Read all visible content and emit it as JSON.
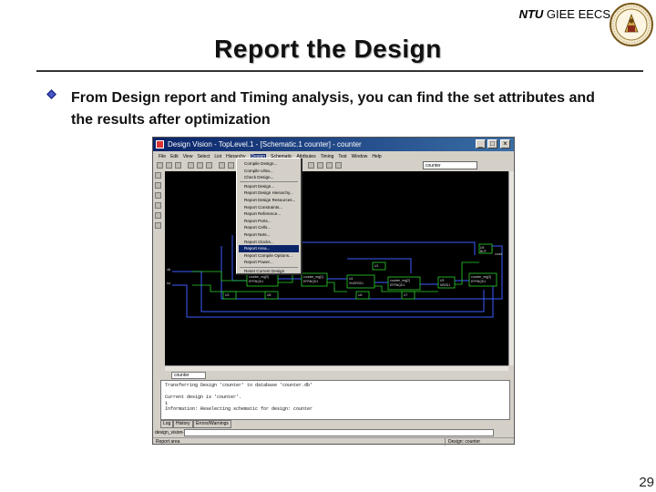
{
  "slide": {
    "org_bold": "NTU",
    "org_rest": " GIEE EECS",
    "title": "Report the Design",
    "bullet": "From Design report and Timing analysis, you can find the set attributes and the results after optimization",
    "page_number": "29"
  },
  "app": {
    "window_title": "Design Vision - TopLevel.1 - [Schematic.1 counter] - counter",
    "menu": [
      "File",
      "Edit",
      "View",
      "Select",
      "List",
      "Hierarchy",
      "Design",
      "Schematic",
      "Attributes",
      "Timing",
      "Test",
      "Window",
      "Help"
    ],
    "open_menu": "Design",
    "design_field": "counter",
    "dropdown_items": [
      "Compile Design...",
      "Compile Ultra...",
      "Check Design...",
      "Report Design...",
      "Report Design Hierarchy...",
      "Report Design Resources...",
      "Report Constraints...",
      "Report Reference...",
      "Report Ports...",
      "Report Cells...",
      "Report Nets...",
      "Report Clocks...",
      "Report Area...",
      "Report Compile Options...",
      "Report Power...",
      "Reset Current Design"
    ],
    "highlighted_item": "Report Area...",
    "schematic_tab": "counter",
    "schematic": {
      "ports_in": [
        "clk",
        "rst"
      ],
      "port_out": "count",
      "cells": [
        {
          "name": "counter_reg[0]",
          "sub": "EFRNQD1"
        },
        {
          "name": "counter_reg[1]",
          "sub": "EFRNQD1"
        },
        {
          "name": "U4",
          "sub": "XNOR2D1"
        },
        {
          "name": "U3",
          "sub": "NR2D1"
        },
        {
          "name": "U8",
          "sub": "XOR2D1"
        },
        {
          "name": "U6",
          "sub": "INR2D1"
        },
        {
          "name": "counter_reg[2]",
          "sub": "EFRNQD1"
        },
        {
          "name": "U9",
          "sub": "NR2D1"
        },
        {
          "name": "U7",
          "sub": "XOR2D1"
        },
        {
          "name": "counter_reg[3]",
          "sub": "EFRNQD1"
        },
        {
          "name": "U5",
          "sub": "BUF"
        }
      ]
    },
    "console_lines": [
      "Transferring Design 'counter' to database 'counter.db'",
      "",
      "Current design is 'counter'.",
      "1",
      "Information: Reselecting schematic for design: counter"
    ],
    "console_tabs": [
      "Log",
      "History",
      "Errors/Warnings"
    ],
    "cmd_label": "design_vision-xg-t>",
    "status_left": "Report area",
    "status_right": "Design: counter"
  }
}
